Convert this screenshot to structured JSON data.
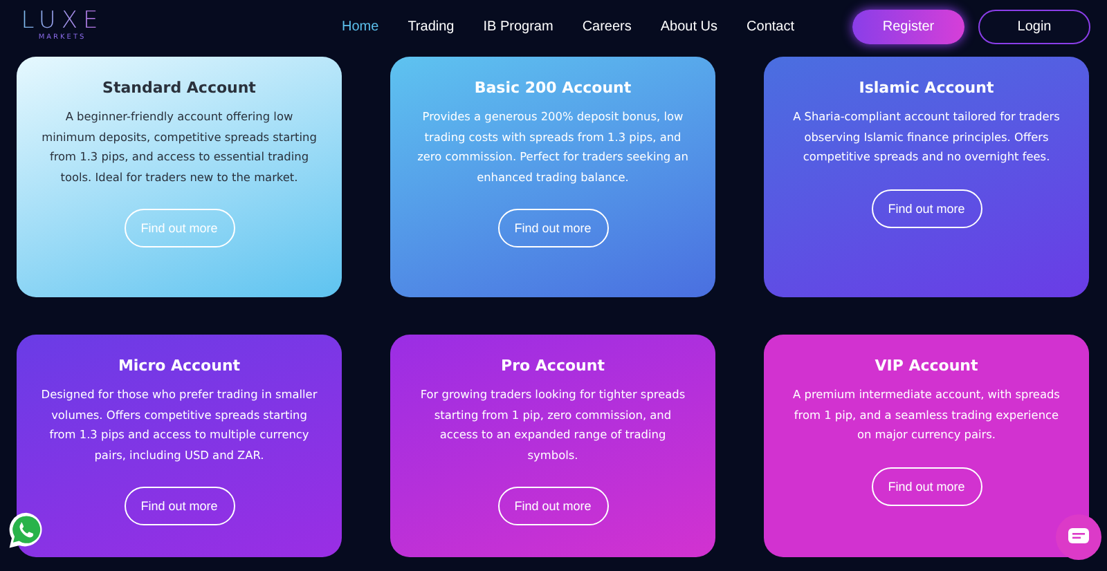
{
  "logo": {
    "name": "LUXE",
    "tagline": "MARKETS"
  },
  "nav": [
    {
      "label": "Home",
      "selected": true
    },
    {
      "label": "Trading",
      "selected": false
    },
    {
      "label": "IB Program",
      "selected": false
    },
    {
      "label": "Careers",
      "selected": false
    },
    {
      "label": "About Us",
      "selected": false
    },
    {
      "label": "Contact",
      "selected": false
    }
  ],
  "actions": [
    {
      "label": "Register",
      "kind": "primary"
    },
    {
      "label": "Login",
      "kind": "outline"
    }
  ],
  "cards": [
    {
      "title": "Standard Account",
      "text": "A beginner-friendly account offering low minimum deposits, competitive spreads starting from 1.3 pips, and access to essential trading tools. Ideal for traders new to the market.",
      "button": "Find out more",
      "color": "#e6f8fe"
    },
    {
      "title": "Basic 200 Account",
      "text": "Provides a generous 200% deposit bonus, low trading costs with spreads from 1.3 pips, and zero commission. Perfect for traders seeking an enhanced trading balance.",
      "button": "Find out more",
      "color": "#5ec3f0"
    },
    {
      "title": "Islamic Account",
      "text": "A Sharia-compliant account tailored for traders observing Islamic finance principles. Offers competitive spreads and no overnight fees.",
      "button": "Find out more",
      "color": "#4a6fe0"
    },
    {
      "title": "Micro Account",
      "text": "Designed for those who prefer trading in smaller volumes. Offers competitive spreads starting from 1.3 pips and access to multiple currency pairs, including USD and ZAR.",
      "button": "Find out more",
      "color": "#6a3ce6"
    },
    {
      "title": "Pro Account",
      "text": "For growing traders looking for tighter spreads starting from 1 pip, zero commission, and access to an expanded range of trading symbols.",
      "button": "Find out more",
      "color": "#9a2ee4"
    },
    {
      "title": "VIP Account",
      "text": "A premium intermediate account, with spreads from 1 pip, and a seamless trading experience on major currency pairs.",
      "button": "Find out more",
      "color": "#d232d0"
    }
  ]
}
